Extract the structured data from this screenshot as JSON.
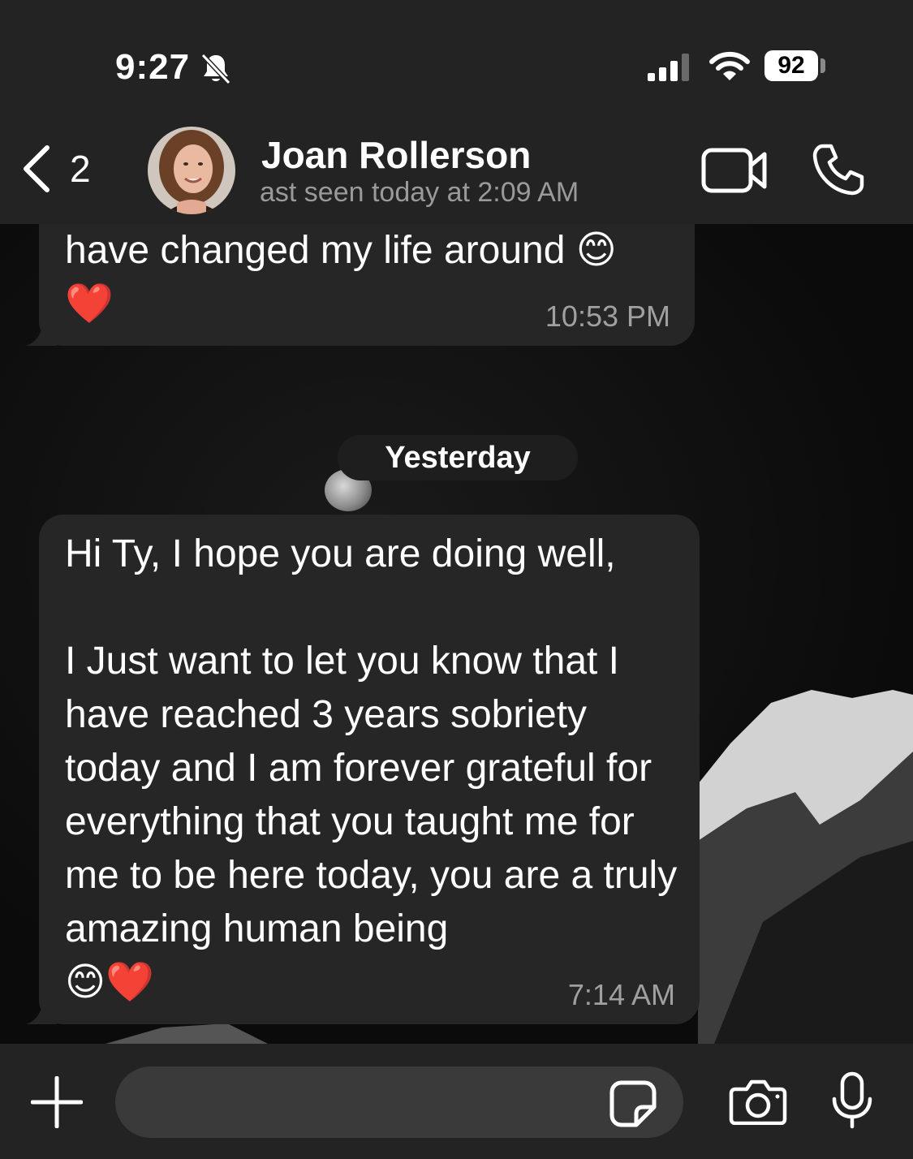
{
  "status_bar": {
    "time": "9:27",
    "battery": "92"
  },
  "header": {
    "back_count": "2",
    "contact_name": "Joan Rollerson",
    "contact_status": "ast seen today at 2:09 AM"
  },
  "messages": [
    {
      "text": "have changed my life around 😊\n❤️",
      "time": "10:53 PM"
    },
    {
      "text": "Hi Ty, I hope you are doing well,\n\nI Just want to let you know that I have reached 3 years sobriety today and I am forever grateful for everything that you taught me for me to be here today, you are a truly amazing human being\n😊❤️",
      "time": "7:14 AM"
    }
  ],
  "date_separator": "Yesterday",
  "composer": {
    "placeholder": ""
  },
  "icons": [
    "bell-off-icon",
    "signal-icon",
    "wifi-icon",
    "battery-icon",
    "chevron-left-icon",
    "video-camera-icon",
    "phone-icon",
    "plus-icon",
    "sticker-icon",
    "camera-icon",
    "microphone-icon"
  ]
}
